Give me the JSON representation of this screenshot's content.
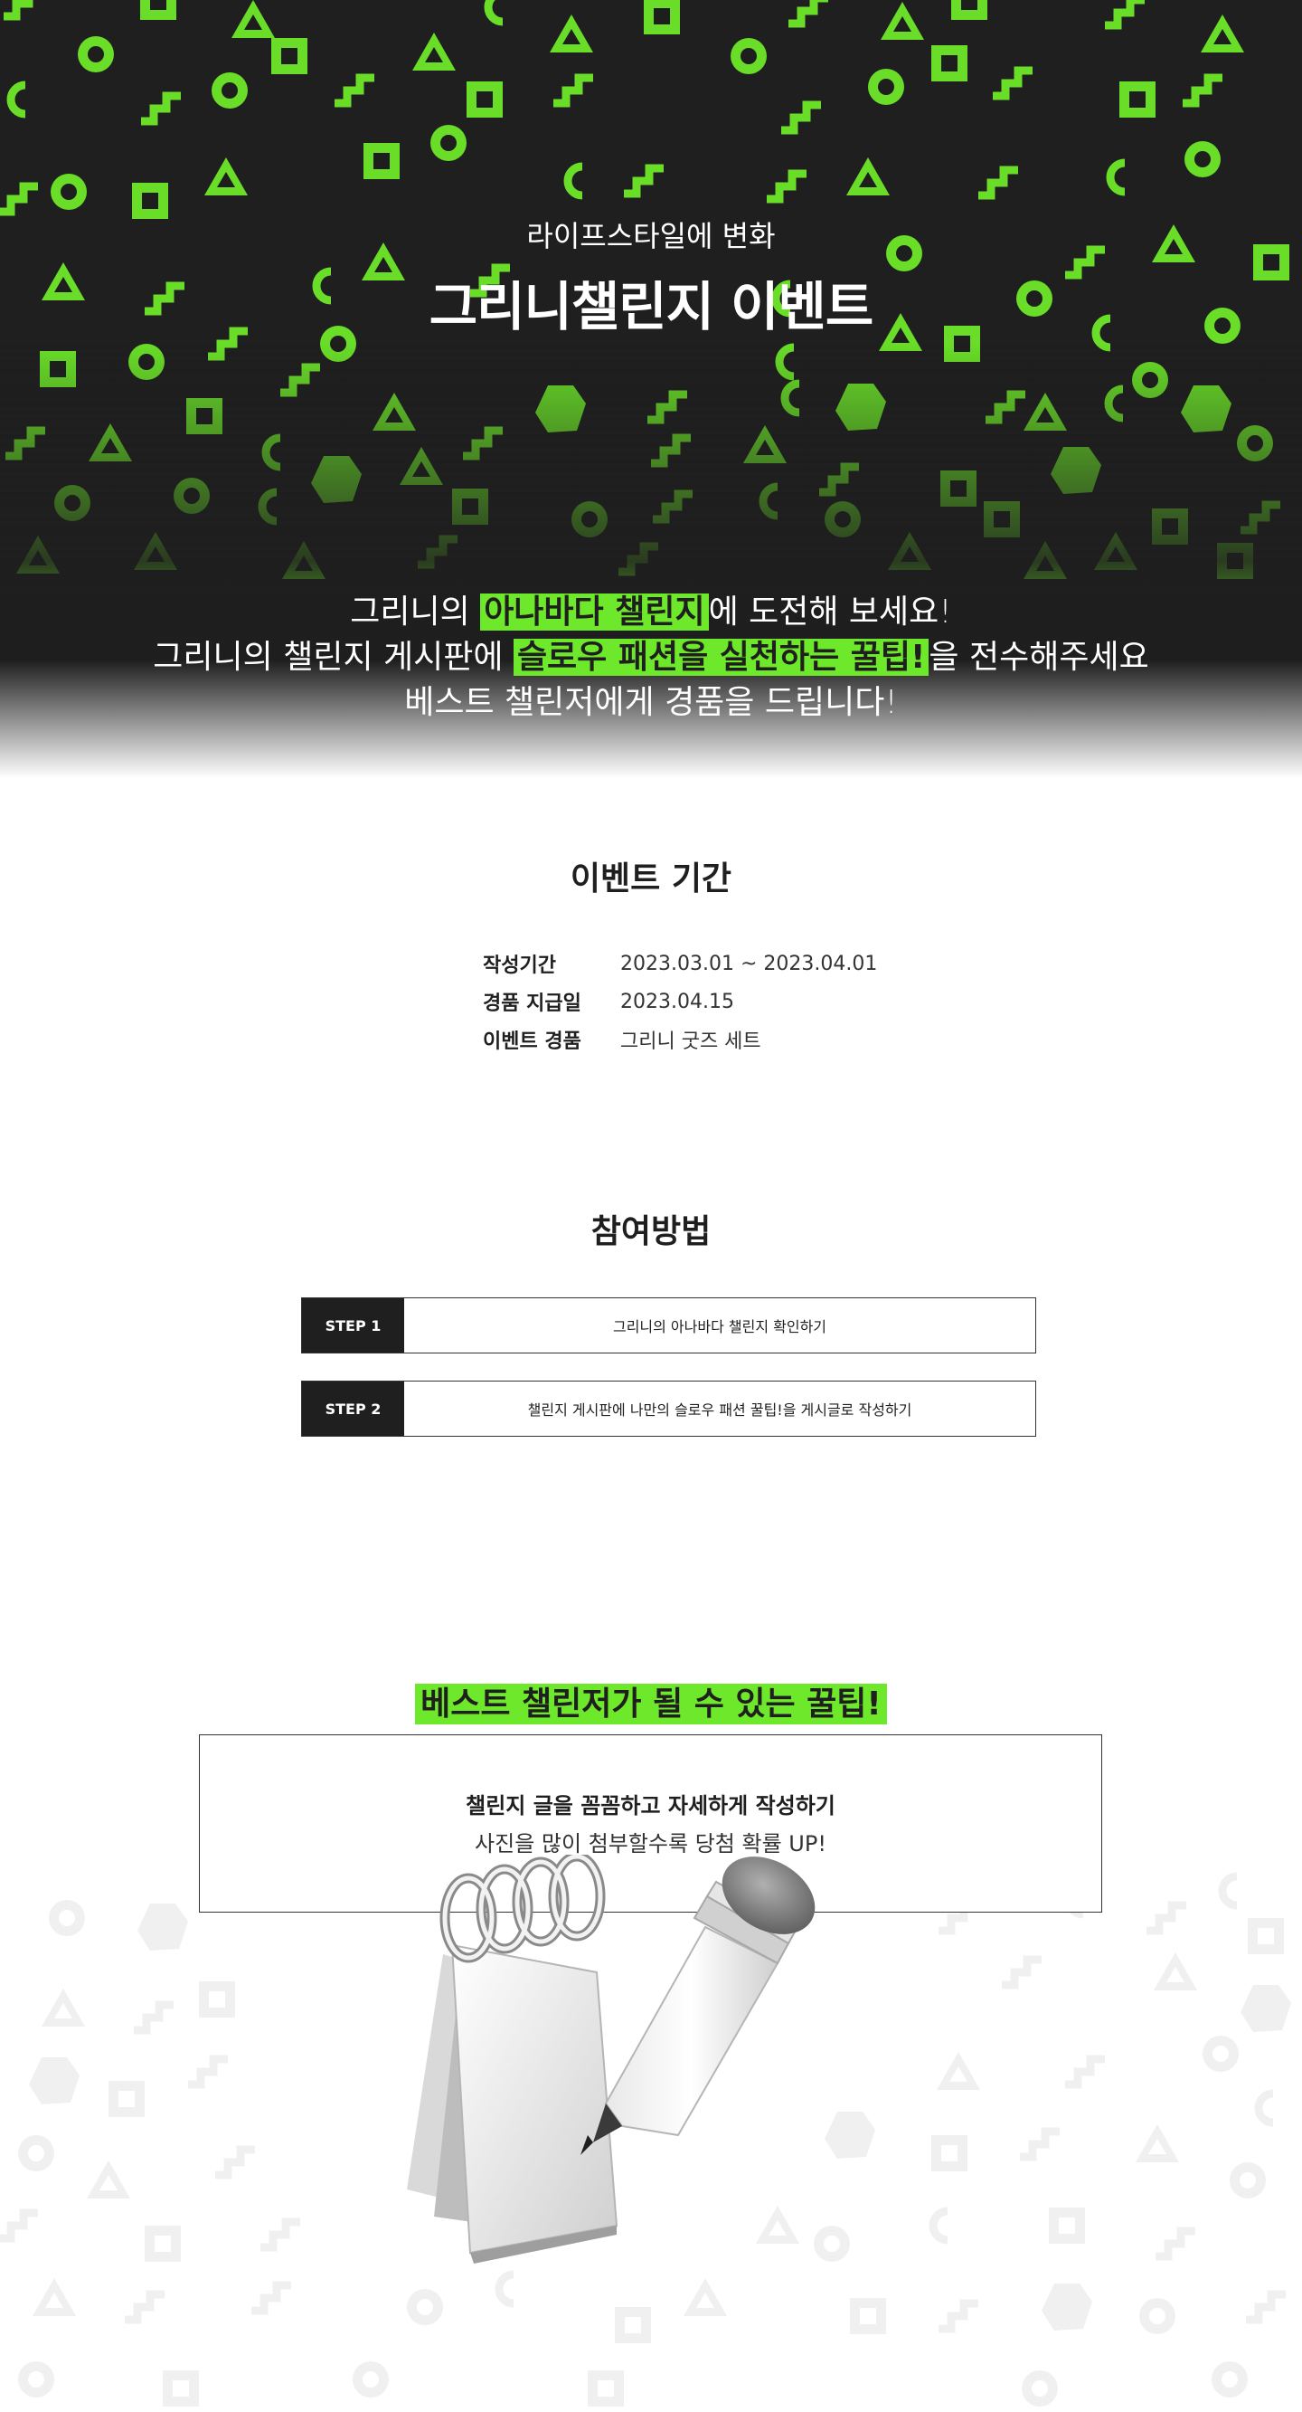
{
  "hero": {
    "subtitle": "라이프스타일에 변화",
    "title": "그리니챌린지 이벤트",
    "line1_pre": "그리니의 ",
    "line1_hl": "아나바다 챌린지",
    "line1_post": "에 도전해 보세요!",
    "line2_pre": "그리니의 챌린지 게시판에 ",
    "line2_hl": "슬로우 패션을 실천하는 꿀팁!",
    "line2_post": "을 전수해주세요",
    "line3": "베스트 챌린저에게 경품을 드립니다!"
  },
  "event": {
    "title": "이벤트 기간",
    "rows": [
      {
        "label": "작성기간",
        "value": "2023.03.01 ~ 2023.04.01"
      },
      {
        "label": "경품 지급일",
        "value": "2023.04.15"
      },
      {
        "label": "이벤트 경품",
        "value": "그리니 굿즈 세트"
      }
    ]
  },
  "participation": {
    "title": "참여방법",
    "steps": [
      {
        "label": "STEP 1",
        "text": "그리니의 아나바다 챌린지 확인하기"
      },
      {
        "label": "STEP 2",
        "text": "챌린지 게시판에 나만의 슬로우 패션 꿀팁!을 게시글로 작성하기"
      }
    ]
  },
  "tips": {
    "title": "베스트 챌린저가 될 수 있는 꿀팁!",
    "line1": "챌린지 글을 꼼꼼하고 자세하게 작성하기",
    "line2": "사진을 많이 첨부할수록 당첨 확률 UP!"
  },
  "colors": {
    "accent": "#6ee82a",
    "dark": "#1f1f1f"
  },
  "icons": [
    "pattern-shapes",
    "notepad-icon",
    "pencil-icon"
  ]
}
